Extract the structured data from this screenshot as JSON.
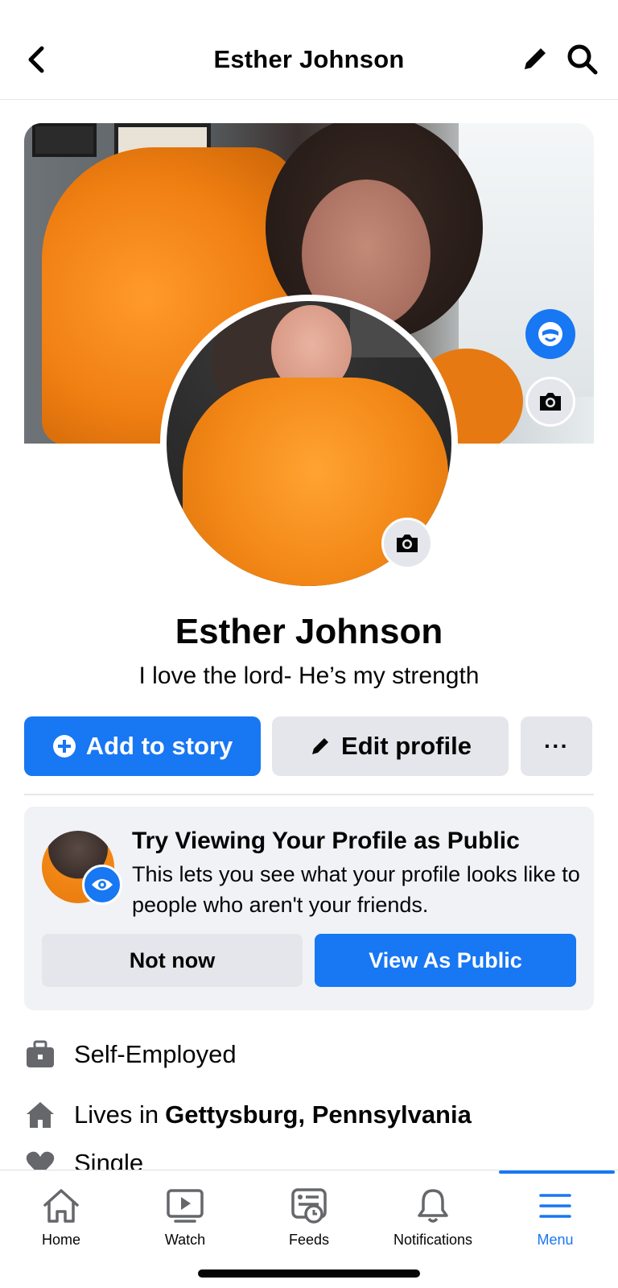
{
  "header": {
    "title": "Esther Johnson",
    "back_icon": "chevron-left-icon",
    "edit_icon": "pencil-icon",
    "search_icon": "search-icon"
  },
  "profile": {
    "name": "Esther Johnson",
    "bio": "I love the lord- He’s my strength"
  },
  "actions": {
    "add_story": "Add to story",
    "edit_profile": "Edit profile",
    "more": "···"
  },
  "public_card": {
    "title": "Try Viewing Your Profile as Public",
    "description": "This lets you see what your profile looks like to people who aren't your friends.",
    "not_now": "Not now",
    "view_public": "View As Public"
  },
  "details": {
    "work": "Self-Employed",
    "lives_prefix": "Lives in",
    "lives_place": "Gettysburg, Pennsylvania",
    "relationship": "Single"
  },
  "tabs": [
    {
      "label": "Home",
      "icon": "home-icon"
    },
    {
      "label": "Watch",
      "icon": "watch-icon"
    },
    {
      "label": "Feeds",
      "icon": "feeds-icon"
    },
    {
      "label": "Notifications",
      "icon": "bell-icon"
    },
    {
      "label": "Menu",
      "icon": "menu-icon",
      "active": true
    }
  ],
  "colors": {
    "accent": "#1877f2",
    "button_gray": "#e4e6eb",
    "card_bg": "#f0f2f5",
    "text": "#050505"
  }
}
